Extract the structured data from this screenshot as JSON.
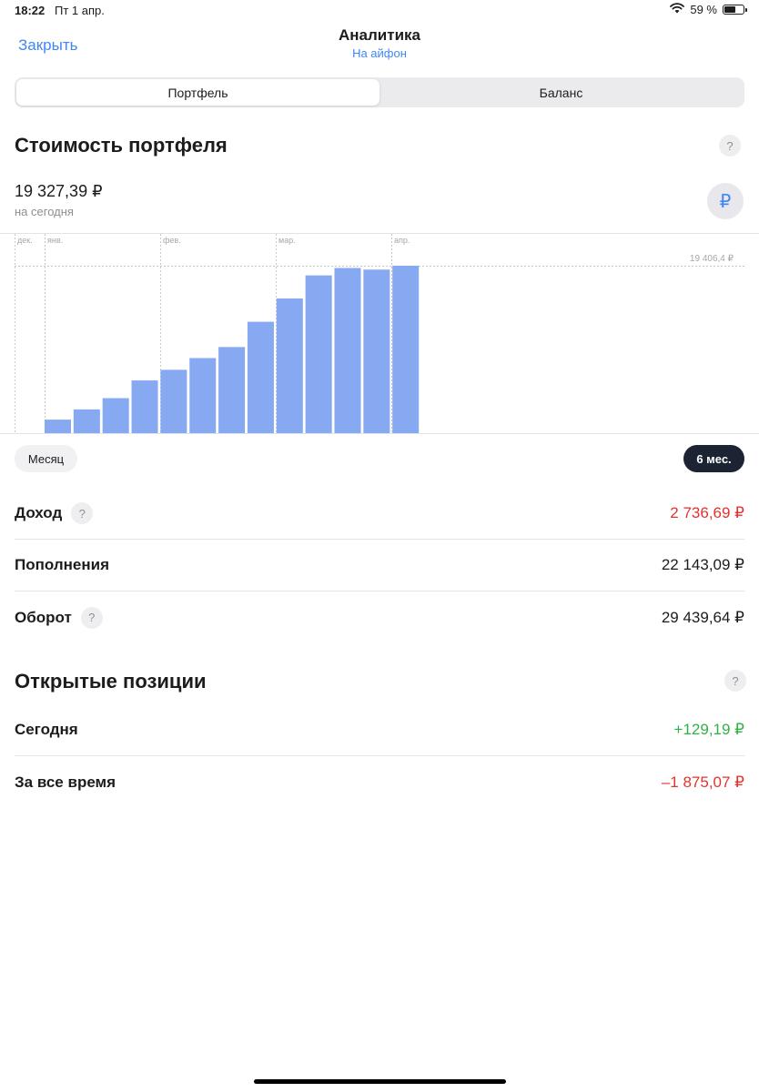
{
  "status": {
    "time": "18:22",
    "date": "Пт 1 апр.",
    "battery": "59 %",
    "battery_level": 0.59
  },
  "nav": {
    "close_label": "Закрыть",
    "title": "Аналитика",
    "subtitle": "На айфон"
  },
  "tabs": [
    {
      "label": "Портфель",
      "active": true
    },
    {
      "label": "Баланс",
      "active": false
    }
  ],
  "portfolio": {
    "title": "Стоимость портфеля",
    "help": "?",
    "value": "19 327,39 ₽",
    "value_caption": "на сегодня",
    "currency_symbol": "₽"
  },
  "chart_data": {
    "type": "bar",
    "month_labels": [
      "дек.",
      "янв.",
      "фев.",
      "мар.",
      "апр."
    ],
    "max_label": "19 406,4 ₽",
    "values": [
      1260,
      2210,
      3260,
      4910,
      5900,
      6990,
      8020,
      10370,
      12540,
      14690,
      15380,
      15230,
      15590
    ],
    "ylim": [
      0,
      15590
    ],
    "bar_color": "#86a9f2"
  },
  "periods": {
    "month": "Месяц",
    "six_months": "6 мес."
  },
  "stats": [
    {
      "label": "Доход",
      "value": "2 736,69 ₽",
      "help": "?",
      "color": "red"
    },
    {
      "label": "Пополнения",
      "value": "22 143,09 ₽",
      "help": "",
      "color": ""
    },
    {
      "label": "Оборот",
      "value": "29 439,64 ₽",
      "help": "?",
      "color": ""
    }
  ],
  "positions": {
    "title": "Открытые позиции",
    "help": "?",
    "rows": [
      {
        "label": "Сегодня",
        "value": "+129,19 ₽",
        "color": "green"
      },
      {
        "label": "За все время",
        "value": "–1 875,07 ₽",
        "color": "red"
      }
    ]
  }
}
